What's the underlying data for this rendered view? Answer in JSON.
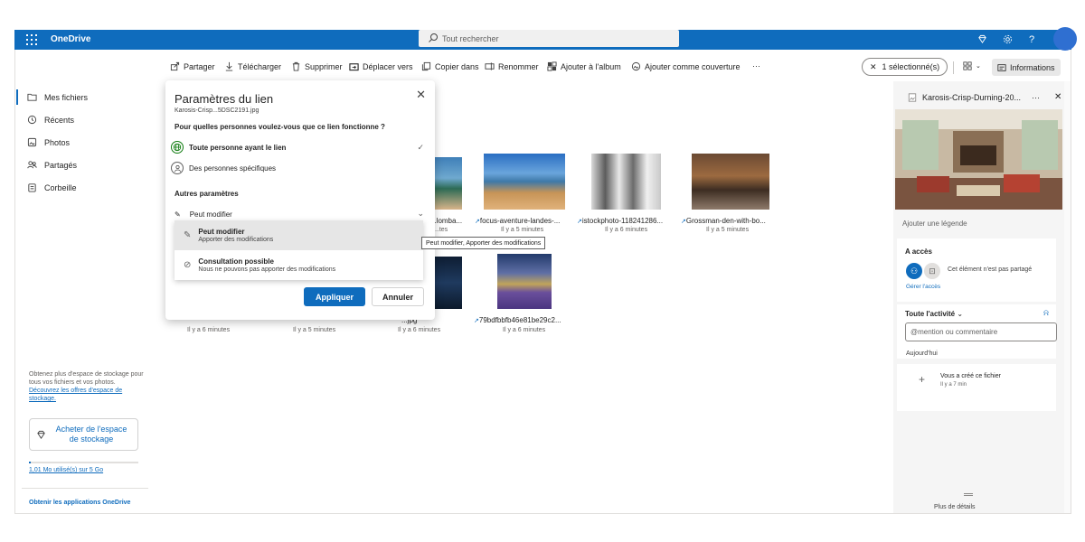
{
  "app": {
    "title": "OneDrive",
    "search_placeholder": "Tout rechercher",
    "accent": "#0f6cbd"
  },
  "toolbar": {
    "share": "Partager",
    "download": "Télécharger",
    "delete": "Supprimer",
    "move": "Déplacer vers",
    "copy": "Copier dans",
    "rename": "Renommer",
    "album": "Ajouter à l'album",
    "cover": "Ajouter comme couverture",
    "more": "···",
    "selected": "1 sélectionné(s)",
    "info": "Informations"
  },
  "nav": {
    "items": [
      "Mes fichiers",
      "Récents",
      "Photos",
      "Partagés",
      "Corbeille"
    ],
    "storage_promo": "Obtenez plus d'espace de stockage pour tous vos fichiers et vos photos.",
    "storage_link": "Découvrez les offres d'espace de stockage.",
    "buy_button": "Acheter de l'espace de stockage",
    "usage": "1,01 Mo utilisé(s) sur 5 Go",
    "usage_fraction": 0.02,
    "get_apps": "Obtenir les applications OneDrive"
  },
  "files": {
    "row1": [
      {
        "name": "...lomba...",
        "date": "...tes"
      },
      {
        "name": "focus-aventure-landes-...",
        "date": "Il y a 5 minutes"
      },
      {
        "name": "istockphoto-118241286...",
        "date": "Il y a 6 minutes"
      },
      {
        "name": "Grossman-den-with-bo...",
        "date": "Il y a 5 minutes"
      }
    ],
    "row2": [
      {
        "name": "",
        "date": "Il y a 6 minutes"
      },
      {
        "name": "",
        "date": "Il y a 5 minutes"
      },
      {
        "name": "...jpg",
        "date": "Il y a 6 minutes"
      },
      {
        "name": "79bdfbbfb46e81be29c2...",
        "date": "Il y a 6 minutes"
      }
    ]
  },
  "dialog": {
    "title": "Paramètres du lien",
    "file": "Karosis-Crisp...5DSC2191.jpg",
    "question": "Pour quelles personnes voulez-vous que ce lien fonctionne ?",
    "option_anyone": "Toute personne ayant le lien",
    "option_specific": "Des personnes spécifiques",
    "other_settings": "Autres paramètres",
    "permission": "Peut modifier",
    "menu": [
      {
        "title": "Peut modifier",
        "desc": "Apporter des modifications"
      },
      {
        "title": "Consultation possible",
        "desc": "Nous ne pouvons pas apporter des modifications"
      }
    ],
    "tooltip": "Peut modifier, Apporter des modifications",
    "apply": "Appliquer",
    "cancel": "Annuler"
  },
  "details": {
    "filename": "Karosis-Crisp-Durning-20...",
    "more": "···",
    "caption_placeholder": "Ajouter une légende",
    "access_title": "A accès",
    "access_text": "Cet élément n'est pas partagé",
    "manage_access": "Gérer l'accès",
    "activity_title": "Toute l'activité",
    "mention_placeholder": "@mention ou commentaire",
    "today": "Aujourd'hui",
    "activity_item": "Vous a créé ce fichier",
    "activity_time": "Il y a 7 min",
    "more_details": "Plus de détails"
  }
}
